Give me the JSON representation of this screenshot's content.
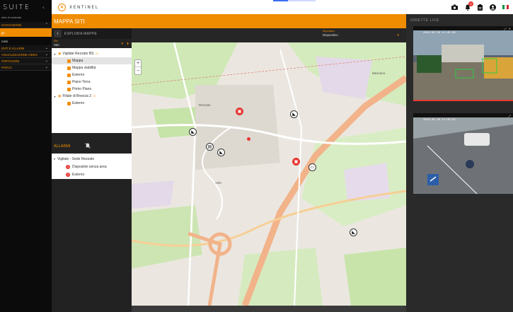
{
  "nav": {
    "brand": "SUITE",
    "back_icon": "chevron-left-icon",
    "subtitle": "nelo di controllo",
    "items": [
      {
        "label": "NAVIGAZIONE",
        "type": "section",
        "expanded": true
      },
      {
        "label": "ge",
        "type": "item",
        "active": true
      },
      {
        "label": "rossi",
        "type": "item",
        "active": false
      },
      {
        "label": "ENTI E ALLARMI",
        "type": "section",
        "expanded": false
      },
      {
        "label": "VISUALIZZAZIONE VIDEO",
        "type": "section",
        "expanded": false
      },
      {
        "label": "PORTAZIONI",
        "type": "section",
        "expanded": false
      },
      {
        "label": "PARCO",
        "type": "section",
        "expanded": false
      }
    ]
  },
  "topbar": {
    "logo_text": "XENTINEL",
    "notification_count": "3",
    "progress": 0.35,
    "icons": [
      "camera-icon",
      "bell-icon",
      "clipboard-icon",
      "user-icon",
      "italy-flag-icon"
    ],
    "flag_colors": [
      "#009246",
      "#ffffff",
      "#ce2b37"
    ]
  },
  "page": {
    "title": "MAPPA SITI"
  },
  "explorer": {
    "title": "ESPLORA MAPPE",
    "site_label": "Sito",
    "site_value": "Sito",
    "tree": [
      {
        "label": "Vigilate Rezzato BS",
        "level": 0,
        "kind": "site",
        "expanded": true
      },
      {
        "label": "Mappa",
        "level": 1,
        "kind": "map",
        "selected": true
      },
      {
        "label": "Mappa viabilità",
        "level": 1,
        "kind": "map"
      },
      {
        "label": "Esterno",
        "level": 1,
        "kind": "plan"
      },
      {
        "label": "Piano Terra",
        "level": 1,
        "kind": "plan"
      },
      {
        "label": "Primo Piano",
        "level": 1,
        "kind": "plan"
      },
      {
        "label": "Filiale di Brescia 2",
        "level": 0,
        "kind": "site",
        "expanded": true
      },
      {
        "label": "Esterno",
        "level": 1,
        "kind": "plan"
      }
    ]
  },
  "alarms": {
    "title": "ALLARMI",
    "group": "Vigilate - Sede Rezzato",
    "items": [
      {
        "num": "1",
        "label": "Dispositivi senza area"
      },
      {
        "num": "2",
        "label": "Esterno"
      }
    ]
  },
  "map": {
    "device_label": "Dispositivo",
    "device_value": "Dispositivo",
    "zoom_in": "+",
    "zoom_out": "−",
    "places": [
      "Rezzato",
      "Mazzano",
      "Virle"
    ]
  },
  "live": {
    "title": "DIRETTE LIVE",
    "cams": [
      {
        "stamp": "2019-05-30 11:45:30",
        "kind": "yard"
      },
      {
        "stamp": "2019-05-30 11:45:32",
        "kind": "road"
      }
    ]
  },
  "colors": {
    "accent": "#f08c00",
    "alarm": "#e53935"
  }
}
